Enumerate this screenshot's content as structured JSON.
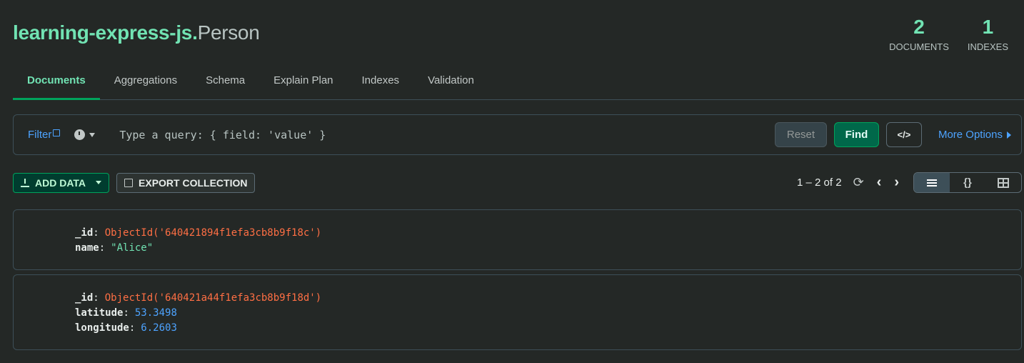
{
  "header": {
    "db": "learning-express-js.",
    "collection": "Person"
  },
  "stats": [
    {
      "value": "2",
      "label": "DOCUMENTS"
    },
    {
      "value": "1",
      "label": "INDEXES"
    }
  ],
  "tabs": [
    "Documents",
    "Aggregations",
    "Schema",
    "Explain Plan",
    "Indexes",
    "Validation"
  ],
  "filter": {
    "label": "Filter",
    "placeholder": "Type a query: { field: 'value' }",
    "reset": "Reset",
    "find": "Find",
    "code": "</>",
    "more_options": "More Options"
  },
  "toolbar": {
    "add_data": "ADD DATA",
    "export": "EXPORT COLLECTION",
    "pager": "1 – 2 of 2"
  },
  "documents": [
    {
      "fields": [
        {
          "key": "_id",
          "value": "ObjectId('640421894f1efa3cb8b9f18c')",
          "type": "oid"
        },
        {
          "key": "name",
          "value": "\"Alice\"",
          "type": "str"
        }
      ]
    },
    {
      "fields": [
        {
          "key": "_id",
          "value": "ObjectId('640421a44f1efa3cb8b9f18d')",
          "type": "oid"
        },
        {
          "key": "latitude",
          "value": "53.3498",
          "type": "num"
        },
        {
          "key": "longitude",
          "value": "6.2603",
          "type": "num"
        }
      ]
    }
  ]
}
